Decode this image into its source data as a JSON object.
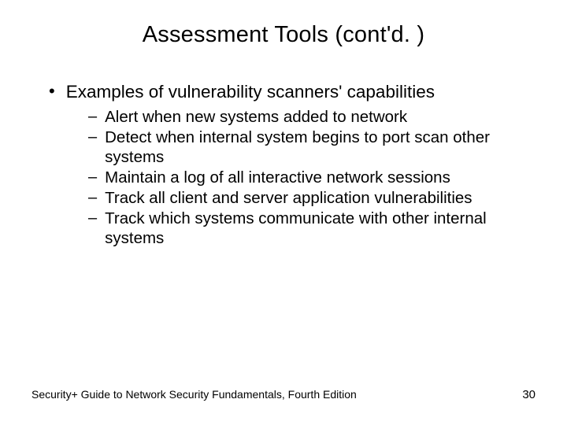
{
  "slide": {
    "title": "Assessment Tools (cont'd. )",
    "bullet": {
      "marker": "•",
      "text": "Examples of vulnerability scanners' capabilities"
    },
    "subitems": [
      {
        "marker": "–",
        "text": "Alert when new systems added to network"
      },
      {
        "marker": "–",
        "text": "Detect when internal system begins to port scan other systems"
      },
      {
        "marker": "–",
        "text": "Maintain a log of all interactive network sessions"
      },
      {
        "marker": "–",
        "text": "Track all client and server application vulnerabilities"
      },
      {
        "marker": "–",
        "text": "Track which systems communicate with other internal systems"
      }
    ],
    "footer": {
      "source": "Security+ Guide to Network Security Fundamentals, Fourth Edition",
      "page": "30"
    }
  }
}
